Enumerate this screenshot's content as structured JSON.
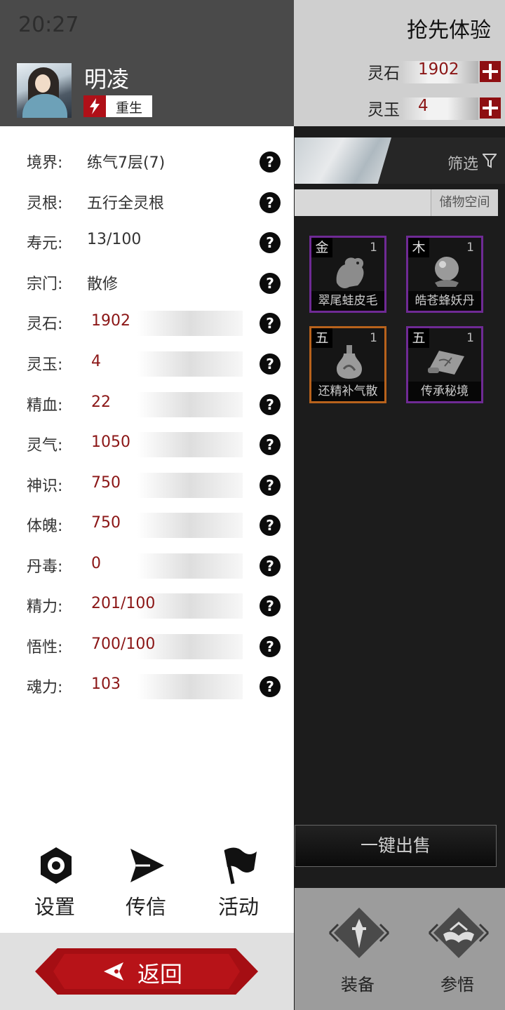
{
  "status_bar": {
    "time": "20:27"
  },
  "right_panel": {
    "title": "抢先体验",
    "resources": [
      {
        "label": "灵石",
        "value": "1902"
      },
      {
        "label": "灵玉",
        "value": "4"
      }
    ],
    "filter_label": "筛选",
    "storage_label": "储物空间",
    "items": [
      {
        "element": "金",
        "qty": "1",
        "name": "翠尾蛙皮毛",
        "rarity_color": "#6f2a95",
        "icon": "frog-pelt-icon"
      },
      {
        "element": "木",
        "qty": "1",
        "name": "皓苍蜂妖丹",
        "rarity_color": "#6f2a95",
        "icon": "pearl-orb-icon"
      },
      {
        "element": "五",
        "qty": "1",
        "name": "还精补气散",
        "rarity_color": "#b8621c",
        "icon": "gourd-bottle-icon"
      },
      {
        "element": "五",
        "qty": "1",
        "name": "传承秘境",
        "rarity_color": "#6f2a95",
        "icon": "map-scroll-icon"
      }
    ],
    "sell_all_label": "一键出售",
    "bottom_buttons": [
      {
        "label": "装备",
        "icon": "sword-emblem-icon"
      },
      {
        "label": "参悟",
        "icon": "open-book-icon"
      }
    ]
  },
  "drawer": {
    "player": {
      "name": "明凌",
      "tag": "重生"
    },
    "stats_plain": [
      {
        "label": "境界:",
        "value": "练气7层(7)"
      },
      {
        "label": "灵根:",
        "value": "五行全灵根"
      },
      {
        "label": "寿元:",
        "value": "13/100"
      },
      {
        "label": "宗门:",
        "value": "散修"
      }
    ],
    "stats_bar": [
      {
        "label": "灵石:",
        "value": "1902"
      },
      {
        "label": "灵玉:",
        "value": "4"
      },
      {
        "label": "精血:",
        "value": "22"
      },
      {
        "label": "灵气:",
        "value": "1050"
      },
      {
        "label": "神识:",
        "value": "750"
      },
      {
        "label": "体魄:",
        "value": "750"
      },
      {
        "label": "丹毒:",
        "value": "0"
      },
      {
        "label": "精力:",
        "value": "201/100"
      },
      {
        "label": "悟性:",
        "value": "700/100"
      },
      {
        "label": "魂力:",
        "value": "103"
      }
    ],
    "help_glyph": "?",
    "menu": [
      {
        "label": "设置",
        "icon": "settings-icon"
      },
      {
        "label": "传信",
        "icon": "send-icon"
      },
      {
        "label": "活动",
        "icon": "flag-icon"
      }
    ],
    "back_label": "返回"
  },
  "colors": {
    "accent_red": "#a50e13",
    "value_red": "#8b1616",
    "rarity_purple": "#6f2a95",
    "rarity_orange": "#b8621c"
  }
}
